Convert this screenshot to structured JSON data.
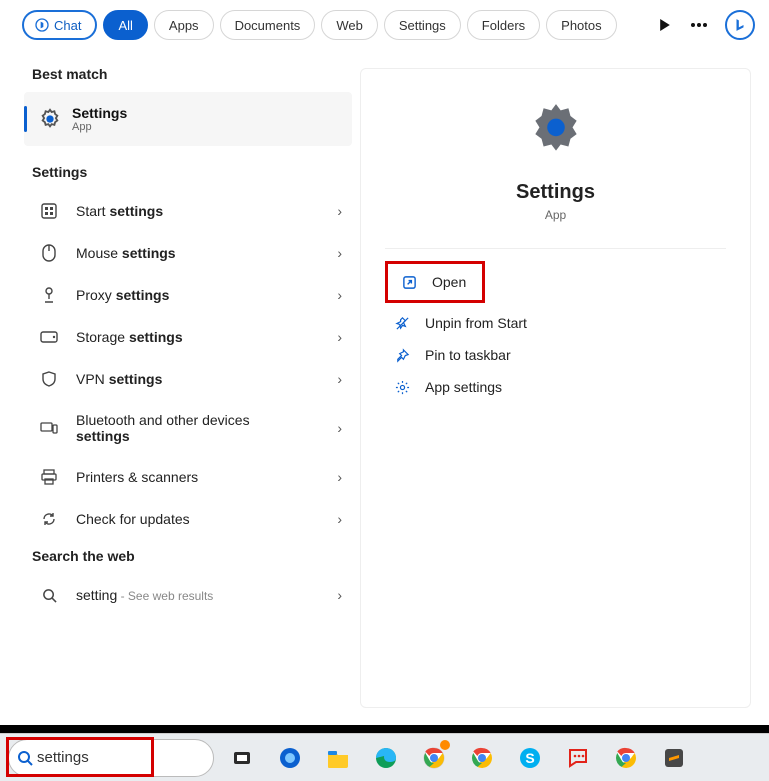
{
  "tabs": {
    "chat": "Chat",
    "all": "All",
    "apps": "Apps",
    "documents": "Documents",
    "web": "Web",
    "settings": "Settings",
    "folders": "Folders",
    "photos": "Photos"
  },
  "left": {
    "best_match_header": "Best match",
    "best": {
      "title": "Settings",
      "subtitle": "App"
    },
    "settings_header": "Settings",
    "rows": [
      {
        "prefix": "Start ",
        "bold": "settings"
      },
      {
        "prefix": "Mouse ",
        "bold": "settings"
      },
      {
        "prefix": "Proxy ",
        "bold": "settings"
      },
      {
        "prefix": "Storage ",
        "bold": "settings"
      },
      {
        "prefix": "VPN ",
        "bold": "settings"
      },
      {
        "prefix": "Bluetooth and other devices ",
        "bold": "settings",
        "twoLine": true
      },
      {
        "prefix": "Printers & scanners",
        "bold": ""
      },
      {
        "prefix": "Check for updates",
        "bold": ""
      }
    ],
    "web_header": "Search the web",
    "web": {
      "term": "setting",
      "suffix": " - See web results"
    }
  },
  "preview": {
    "title": "Settings",
    "subtitle": "App",
    "actions": {
      "open": "Open",
      "unpin": "Unpin from Start",
      "pin_tb": "Pin to taskbar",
      "app_settings": "App settings"
    }
  },
  "taskbar": {
    "search_value": "settings"
  }
}
